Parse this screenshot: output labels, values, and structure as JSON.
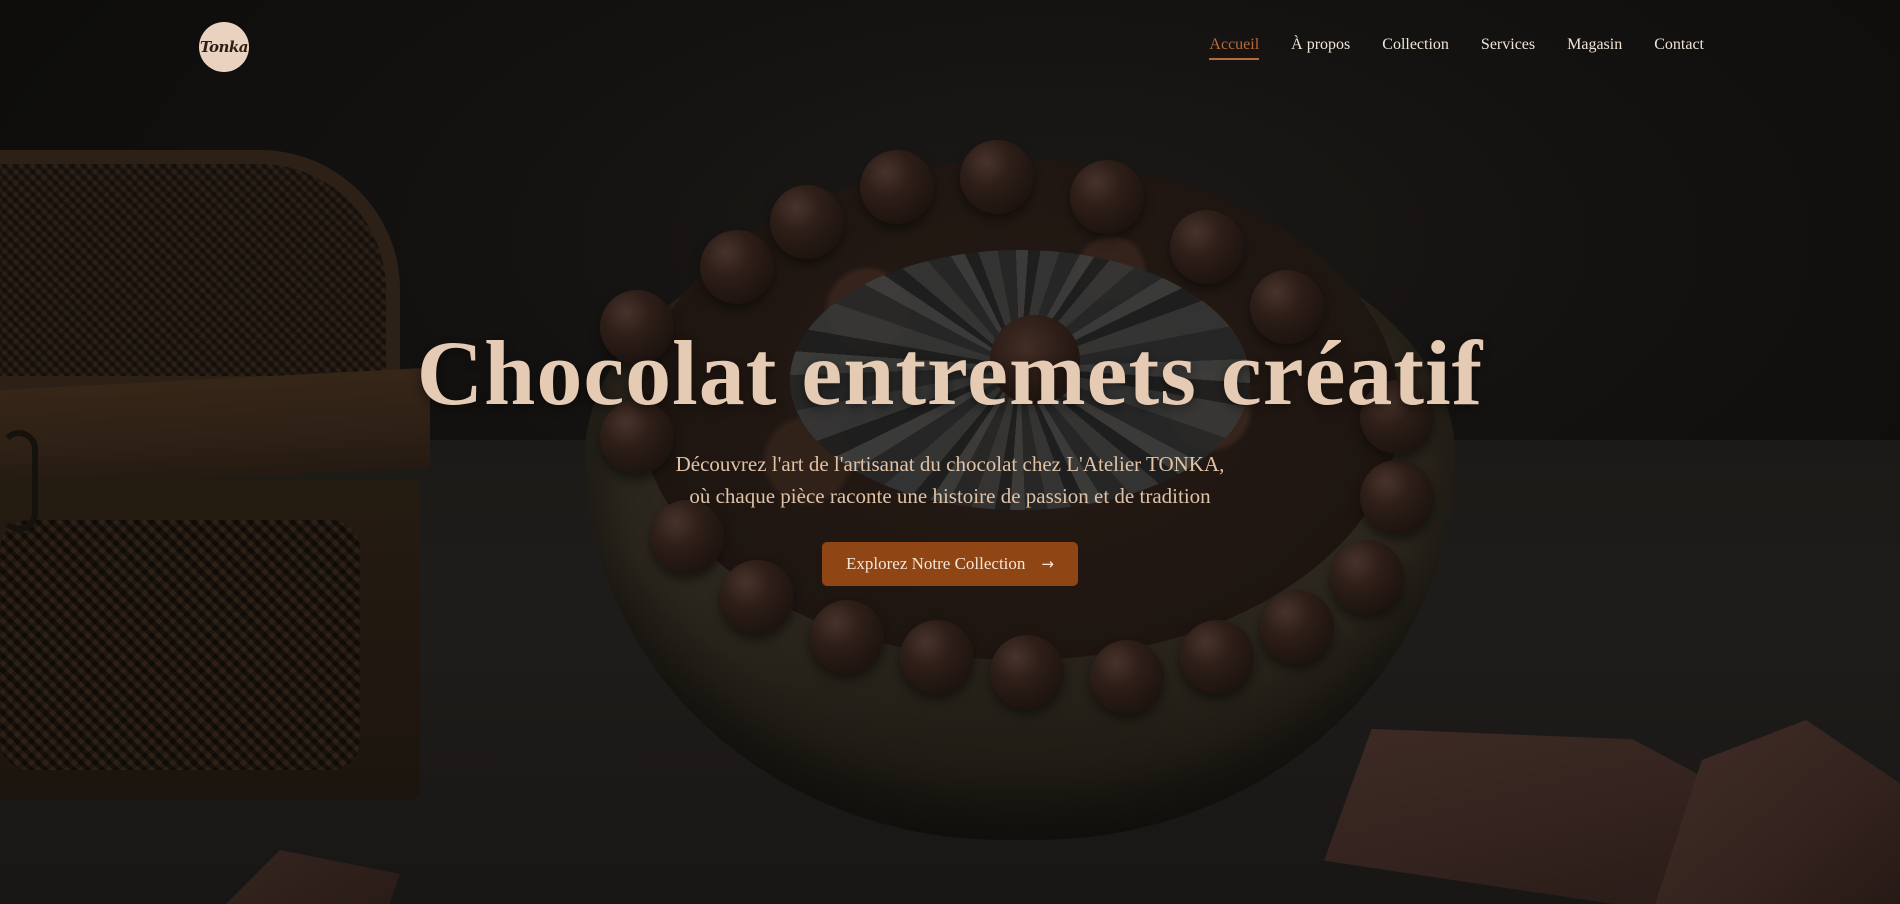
{
  "brand": {
    "logo_text": "Tonka",
    "logo_icon": "tonka-logo"
  },
  "nav": {
    "items": [
      {
        "label": "Accueil",
        "active": true
      },
      {
        "label": "À propos",
        "active": false
      },
      {
        "label": "Collection",
        "active": false
      },
      {
        "label": "Services",
        "active": false
      },
      {
        "label": "Magasin",
        "active": false
      },
      {
        "label": "Contact",
        "active": false
      }
    ]
  },
  "hero": {
    "title": "Chocolat entremets créatif",
    "subtitle_line1": "Découvrez l'art de l'artisanat du chocolat chez L'Atelier TONKA,",
    "subtitle_line2": "où chaque pièce raconte une histoire de passion et de tradition",
    "cta_label": "Explorez Notre Collection",
    "cta_icon": "arrow-right-icon"
  },
  "colors": {
    "accent": "#b8693a",
    "button": "#8f4614",
    "title": "#e6cbb4",
    "nav_text": "#f1e4d8"
  }
}
